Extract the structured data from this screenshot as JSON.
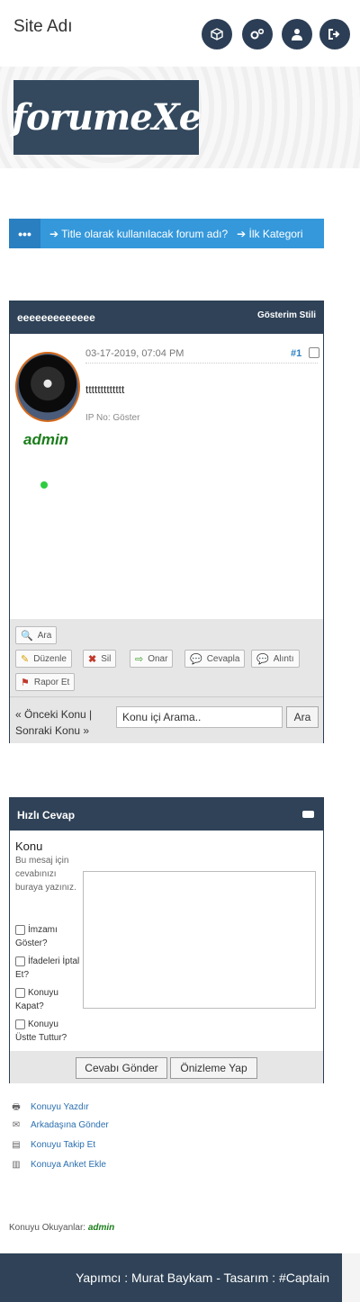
{
  "header": {
    "site_name": "Site Adı",
    "icons": [
      "cube-icon",
      "cogs-icon",
      "user-icon",
      "logout-icon"
    ]
  },
  "logo": {
    "text": "forumeXe"
  },
  "breadcrumb": {
    "menu": "•••",
    "items": [
      "➔ Title olarak kullanılacak forum adı?",
      "➔ İlk Kategori"
    ]
  },
  "post": {
    "title": "eeeeeeeeeeeee",
    "display_mode": "Gösterim Stili",
    "date": "03-17-2019, 07:04 PM",
    "number": "#1",
    "body": "ttttttttttttt",
    "ip": "IP No: Göster",
    "author": "admin",
    "actions": {
      "search": "Ara",
      "edit": "Düzenle",
      "delete": "Sil",
      "fix": "Onar",
      "reply": "Cevapla",
      "quote": "Alıntı",
      "report": "Rapor Et"
    },
    "prev": "« Önceki Konu |",
    "next": "Sonraki Konu »",
    "search_placeholder": "Konu içi Arama..",
    "search_button": "Ara"
  },
  "quick_reply": {
    "title": "Hızlı Cevap",
    "subject_label": "Konu",
    "hint": "Bu mesaj için cevabınızı buraya yazınız.",
    "options": [
      "İmzamı Göster?",
      "İfadeleri İptal Et?",
      "Konuyu Kapat?",
      "Konuyu Üstte Tuttur?"
    ],
    "submit": "Cevabı Gönder",
    "preview": "Önizleme Yap"
  },
  "tools": [
    "Konuyu Yazdır",
    "Arkadaşına Gönder",
    "Konuyu Takip Et",
    "Konuya Anket Ekle"
  ],
  "viewers": {
    "label": "Konuyu Okuyanlar:",
    "user": "admin"
  },
  "footer": {
    "credits": "Yapımcı : Murat Baykam - Tasarım : #Captain"
  },
  "colors": {
    "navy": "#2f4257",
    "accent": "#3498db",
    "online": "#2ecc40",
    "user": "#1b7d1b"
  }
}
